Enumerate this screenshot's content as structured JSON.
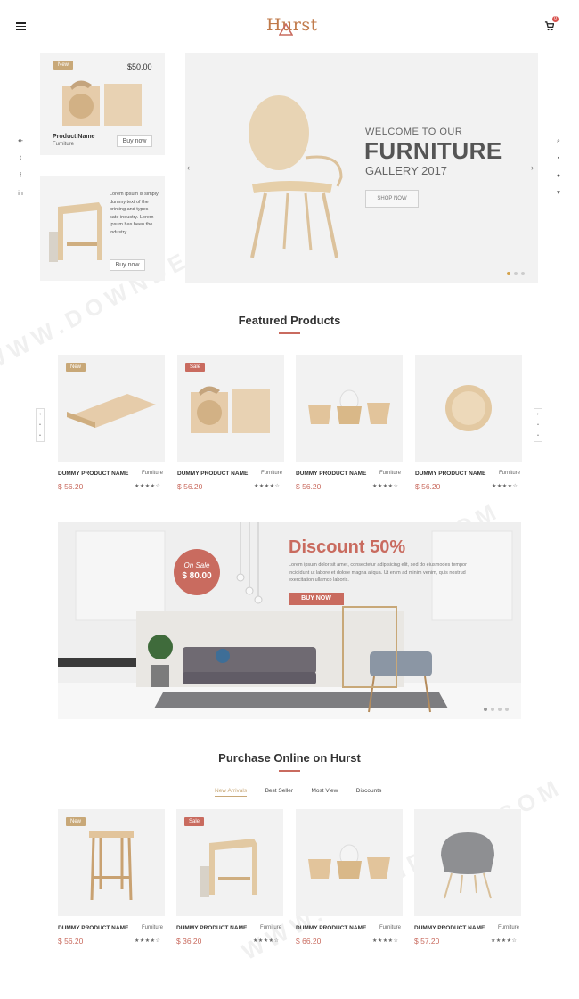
{
  "header": {
    "logo": "Hurst",
    "cart_count": "0"
  },
  "promo_top": {
    "badge": "New",
    "price": "$50.00",
    "name": "Product Name",
    "category": "Furniture",
    "button": "Buy now"
  },
  "promo_bottom": {
    "text": "Lorem Ipsum is simply dummy text of the printing and types sate industry. Lorem Ipsum has been the industry.",
    "button": "Buy now"
  },
  "hero": {
    "welcome": "WELCOME TO OUR",
    "title": "FURNITURE",
    "subtitle": "GALLERY 2017",
    "button": "SHOP NOW"
  },
  "featured": {
    "title": "Featured Products",
    "products": [
      {
        "badge": "New",
        "name": "DUMMY PRODUCT NAME",
        "category": "Furniture",
        "price": "$ 56.20",
        "stars": "★★★★☆"
      },
      {
        "badge": "Sale",
        "name": "DUMMY PRODUCT NAME",
        "category": "Furniture",
        "price": "$ 56.20",
        "stars": "★★★★☆"
      },
      {
        "badge": "",
        "name": "DUMMY PRODUCT NAME",
        "category": "Furniture",
        "price": "$ 56.20",
        "stars": "★★★★☆"
      },
      {
        "badge": "",
        "name": "DUMMY PRODUCT NAME",
        "category": "Furniture",
        "price": "$ 56.20",
        "stars": "★★★★☆"
      }
    ]
  },
  "discount": {
    "title": "Discount 50%",
    "text": "Lorem ipsum dolor sit amet, consectetur adipisicing elit, sed do eiusmodes tempor incididunt ut labore et dolore magna aliqua. Ut enim ad minim venim, quis nostrud exercitation ullamco laboris.",
    "button": "BUY NOW",
    "onsale_label": "On Sale",
    "onsale_price": "$ 80.00"
  },
  "purchase": {
    "title": "Purchase Online on Hurst",
    "tabs": [
      "New Arrivals",
      "Best Seller",
      "Most View",
      "Discounts"
    ],
    "products": [
      {
        "badge": "New",
        "name": "DUMMY PRODUCT NAME",
        "category": "Furniture",
        "price": "$ 56.20",
        "stars": "★★★★☆"
      },
      {
        "badge": "Sale",
        "name": "DUMMY PRODUCT NAME",
        "category": "Furniture",
        "price": "$ 36.20",
        "stars": "★★★★☆"
      },
      {
        "badge": "",
        "name": "DUMMY PRODUCT NAME",
        "category": "Furniture",
        "price": "$ 66.20",
        "stars": "★★★★☆"
      },
      {
        "badge": "",
        "name": "DUMMY PRODUCT NAME",
        "category": "Furniture",
        "price": "$ 57.20",
        "stars": "★★★★☆"
      }
    ]
  },
  "watermark": "WWW.DOWNDEMO.COM",
  "colors": {
    "accent": "#c96b5f",
    "gold": "#c8a878",
    "wood": "#e2c9a3"
  }
}
